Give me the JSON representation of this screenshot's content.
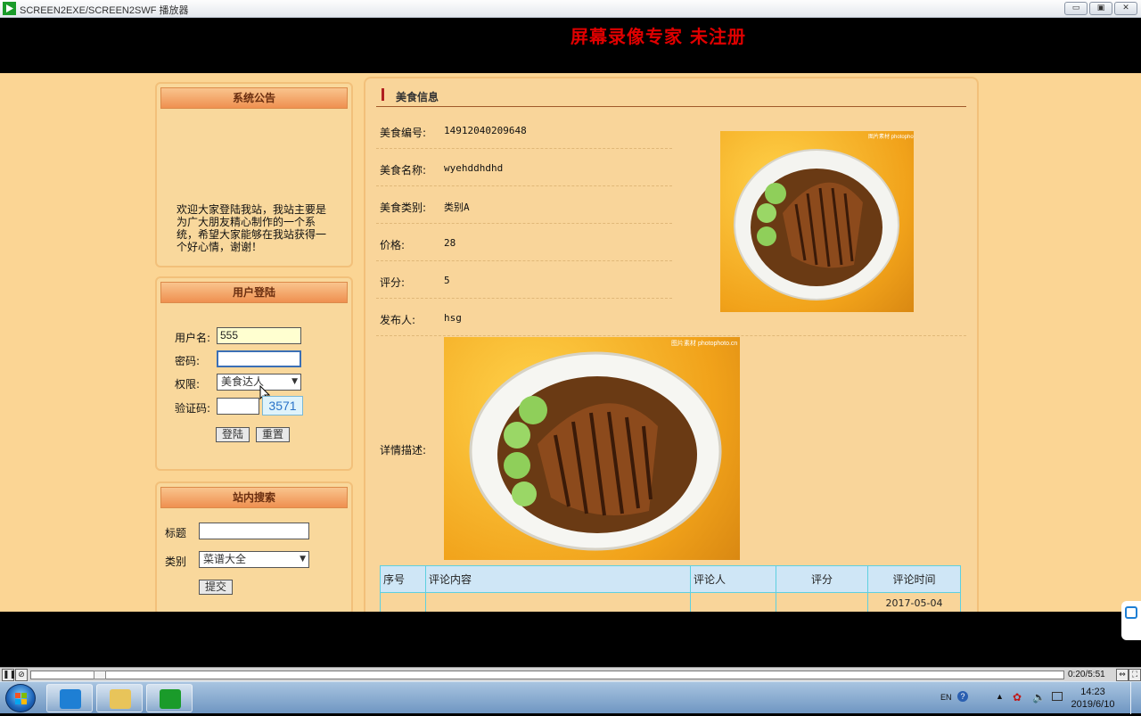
{
  "window": {
    "title": "SCREEN2EXE/SCREEN2SWF 播放器",
    "buttons": {
      "minimize": "▭",
      "restore": "▣",
      "close": "✕"
    }
  },
  "banner": {
    "watermark": "屏幕录像专家  未注册"
  },
  "notice": {
    "title": "系统公告",
    "text": "欢迎大家登陆我站，我站主要是为广大朋友精心制作的一个系统，希望大家能够在我站获得一个好心情，谢谢！"
  },
  "login": {
    "title": "用户登陆",
    "username_label": "用户名:",
    "username_value": "555",
    "password_label": "密码:",
    "password_value": "",
    "role_label": "权限:",
    "role_value": "美食达人",
    "captcha_label": "验证码:",
    "captcha_input": "",
    "captcha_code": "3571",
    "login_button": "登陆",
    "reset_button": "重置"
  },
  "search": {
    "title": "站内搜索",
    "title_label": "标题",
    "title_value": "",
    "category_label": "类别",
    "category_value": "菜谱大全",
    "submit_button": "提交"
  },
  "food": {
    "section_title": "美食信息",
    "fields": [
      {
        "label": "美食编号:",
        "value": "14912040209648"
      },
      {
        "label": "美食名称:",
        "value": "wyehddhdhd"
      },
      {
        "label": "美食类别:",
        "value": "类别A"
      },
      {
        "label": "价格:",
        "value": "28"
      },
      {
        "label": "评分:",
        "value": "5"
      },
      {
        "label": "发布人:",
        "value": "hsg"
      }
    ],
    "detail_label": "详情描述:",
    "image_caption": "图片素材 photophoto.cn"
  },
  "comments": {
    "headers": [
      "序号",
      "评论内容",
      "评论人",
      "评分",
      "评论时间"
    ],
    "rows": [
      {
        "time": "2017-05-04"
      }
    ]
  },
  "player": {
    "time": "0:20/5:51"
  },
  "taskbar": {
    "language": "EN",
    "time": "14:23",
    "date": "2019/6/10"
  },
  "colors": {
    "page_bg": "#fbd594",
    "box_head": "#ef9050",
    "watermark": "#e00000",
    "table_border": "#5ed0e0"
  }
}
